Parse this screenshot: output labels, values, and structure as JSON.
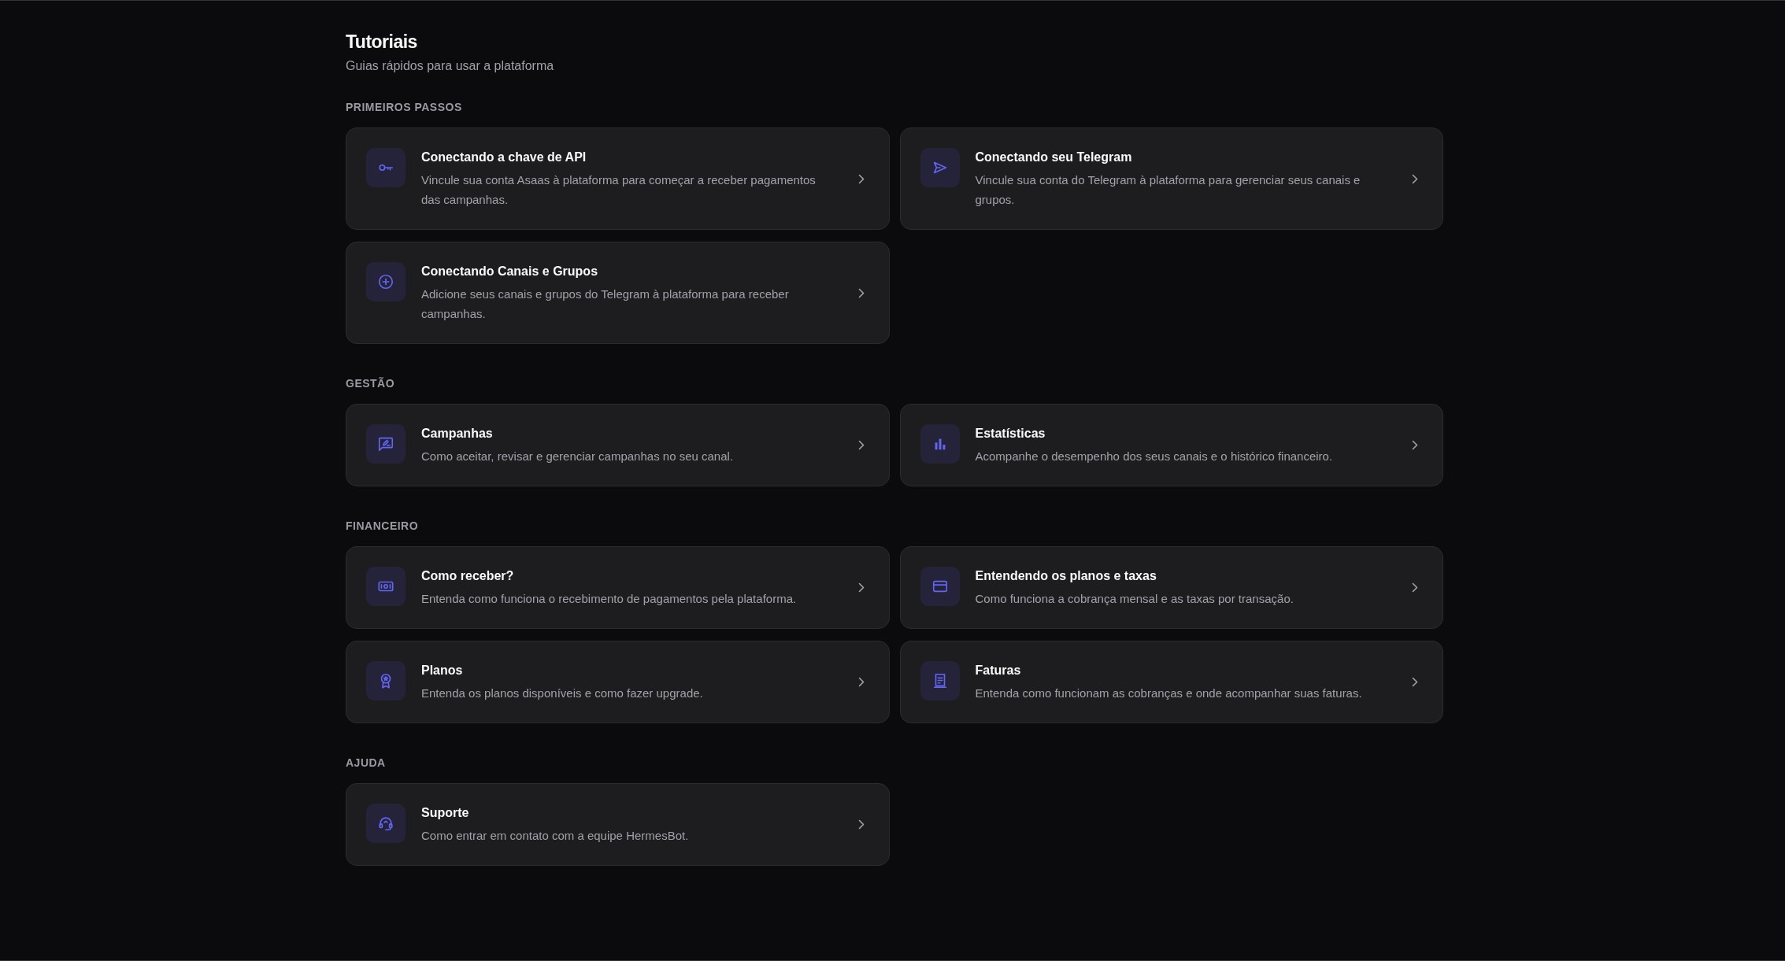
{
  "header": {
    "title": "Tutoriais",
    "subtitle": "Guias rápidos para usar a plataforma"
  },
  "sections": [
    {
      "title": "PRIMEIROS PASSOS",
      "tutorials": [
        {
          "title": "Conectando a chave de API",
          "description": "Vincule sua conta Asaas à plataforma para começar a receber pagamentos das campanhas."
        },
        {
          "title": "Conectando seu Telegram",
          "description": "Vincule sua conta do Telegram à plataforma para gerenciar seus canais e grupos."
        },
        {
          "title": "Conectando Canais e Grupos",
          "description": "Adicione seus canais e grupos do Telegram à plataforma para receber campanhas."
        }
      ]
    },
    {
      "title": "GESTÃO",
      "tutorials": [
        {
          "title": "Campanhas",
          "description": "Como aceitar, revisar e gerenciar campanhas no seu canal."
        },
        {
          "title": "Estatísticas",
          "description": "Acompanhe o desempenho dos seus canais e o histórico financeiro."
        }
      ]
    },
    {
      "title": "FINANCEIRO",
      "tutorials": [
        {
          "title": "Como receber?",
          "description": "Entenda como funciona o recebimento de pagamentos pela plataforma."
        },
        {
          "title": "Entendendo os planos e taxas",
          "description": "Como funciona a cobrança mensal e as taxas por transação."
        },
        {
          "title": "Planos",
          "description": "Entenda os planos disponíveis e como fazer upgrade."
        },
        {
          "title": "Faturas",
          "description": "Entenda como funcionam as cobranças e onde acompanhar suas faturas."
        }
      ]
    },
    {
      "title": "AJUDA",
      "tutorials": [
        {
          "title": "Suporte",
          "description": "Como entrar em contato com a equipe HermesBot."
        }
      ]
    }
  ]
}
